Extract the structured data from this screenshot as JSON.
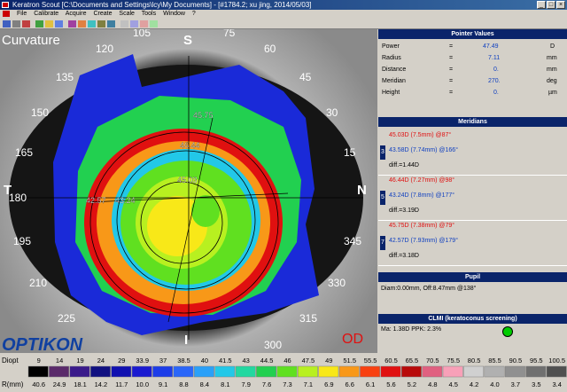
{
  "window": {
    "title": "Keratron Scout [C:\\Documents and Settings\\lcy\\My Documents] - [#1784.2; xu jing, 2014/05/03]",
    "minimize": "_",
    "maximize": "□",
    "close": "×"
  },
  "menu": [
    "File",
    "Calibrate",
    "Acquire",
    "Create",
    "Scale",
    "Tools",
    "Window",
    "?"
  ],
  "map": {
    "mode_label": "Curvature",
    "eye_label": "OD",
    "brand": "OPTIKON",
    "cardinal": {
      "top": "S",
      "bottom": "I",
      "left": "T",
      "right": "N"
    },
    "angle_labels": [
      "105",
      "75",
      "120",
      "60",
      "135",
      "45",
      "150",
      "30",
      "165",
      "15",
      "180",
      "195",
      "345",
      "210",
      "330",
      "225",
      "315",
      "300"
    ],
    "inner_values": [
      "45.75",
      "46.44",
      "45.03",
      "42.57",
      "43.24"
    ]
  },
  "pointer": {
    "title": "Pointer Values",
    "rows": [
      {
        "label": "Power",
        "eq": "=",
        "value": "47.49",
        "unit": "D"
      },
      {
        "label": "Radius",
        "eq": "=",
        "value": "7.11",
        "unit": "mm"
      },
      {
        "label": "Distance",
        "eq": "=",
        "value": "0.",
        "unit": "mm"
      },
      {
        "label": "Meridian",
        "eq": "=",
        "value": "270.",
        "unit": "deg"
      },
      {
        "label": "Height",
        "eq": "=",
        "value": "0.",
        "unit": "µm"
      }
    ]
  },
  "meridians": {
    "title": "Meridians",
    "blocks": [
      {
        "num": "3",
        "steep": "45.03D (7.5mm) @87°",
        "flat": "43.58D (7.74mm) @166°",
        "diff": "diff.=1.44D"
      },
      {
        "num": "5",
        "steep": "46.44D (7.27mm) @98°",
        "flat": "43.24D (7.8mm) @177°",
        "diff": "diff.=3.19D"
      },
      {
        "num": "7",
        "steep": "45.75D (7.38mm) @79°",
        "flat": "42.57D (7.93mm) @179°",
        "diff": "diff.=3.18D"
      }
    ]
  },
  "pupil": {
    "title": "Pupil",
    "text": "Diam:0.00mm, Off:8.47mm @138°"
  },
  "clmi": {
    "title": "CLMI (keratoconus screening)",
    "text": "Ma: 1.38D   PPK: 2.3%",
    "status_color": "#00cc00"
  },
  "scale": {
    "diopt_label": "Diopt",
    "r_label": "R(mm)",
    "diopt": [
      "9",
      "14",
      "19",
      "24",
      "29",
      "33.9",
      "37",
      "38.5",
      "40",
      "41.5",
      "43",
      "44.5",
      "46",
      "47.5",
      "49",
      "51.5",
      "55.5",
      "60.5",
      "65.5",
      "70.5",
      "75.5",
      "80.5",
      "85.5",
      "90.5",
      "95.5",
      "100.5"
    ],
    "r": [
      "40.6",
      "24.9",
      "18.1",
      "14.2",
      "11.7",
      "10.0",
      "9.1",
      "8.8",
      "8.4",
      "8.1",
      "7.9",
      "7.6",
      "7.3",
      "7.1",
      "6.9",
      "6.6",
      "6.1",
      "5.6",
      "5.2",
      "4.8",
      "4.5",
      "4.2",
      "4.0",
      "3.7",
      "3.5",
      "3.4"
    ],
    "colors": [
      "#000000",
      "#5a2a6a",
      "#3a1a8a",
      "#101080",
      "#1010b0",
      "#1a1ad0",
      "#1c3ce8",
      "#2a66f8",
      "#2aa0f8",
      "#22c8e8",
      "#22d8a0",
      "#22d050",
      "#60e020",
      "#b8f020",
      "#f8e818",
      "#f89818",
      "#f84010",
      "#e01010",
      "#b80a0a",
      "#e06080",
      "#f8a0b8",
      "#d0d0d0",
      "#b0b0b0",
      "#909090",
      "#707070",
      "#505050"
    ]
  }
}
